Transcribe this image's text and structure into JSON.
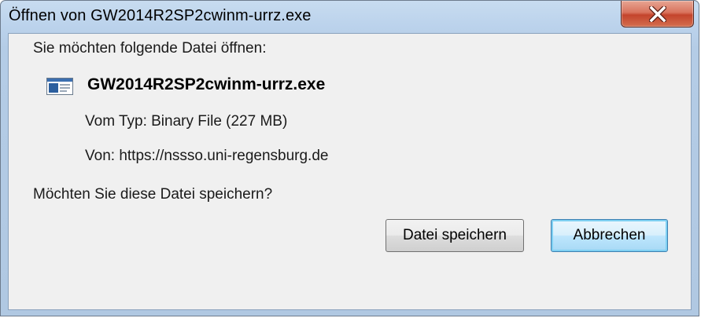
{
  "window": {
    "title": "Öffnen von GW2014R2SP2cwinm-urrz.exe",
    "close_icon": "close-icon"
  },
  "dialog": {
    "prompt": "Sie möchten folgende Datei öffnen:",
    "file_icon": "application-file-icon",
    "file_name": "GW2014R2SP2cwinm-urrz.exe",
    "type_line": "Vom Typ:  Binary File (227 MB)",
    "from_line": "Von:  https://nssso.uni-regensburg.de",
    "question": "Möchten Sie diese Datei speichern?"
  },
  "buttons": {
    "save_label": "Datei speichern",
    "cancel_label": "Abbrechen"
  },
  "colors": {
    "close_button": "#c4442c",
    "frame": "#b4cce6",
    "content_background": "#f0f0f0",
    "default_button_border": "#3c7fb1"
  }
}
